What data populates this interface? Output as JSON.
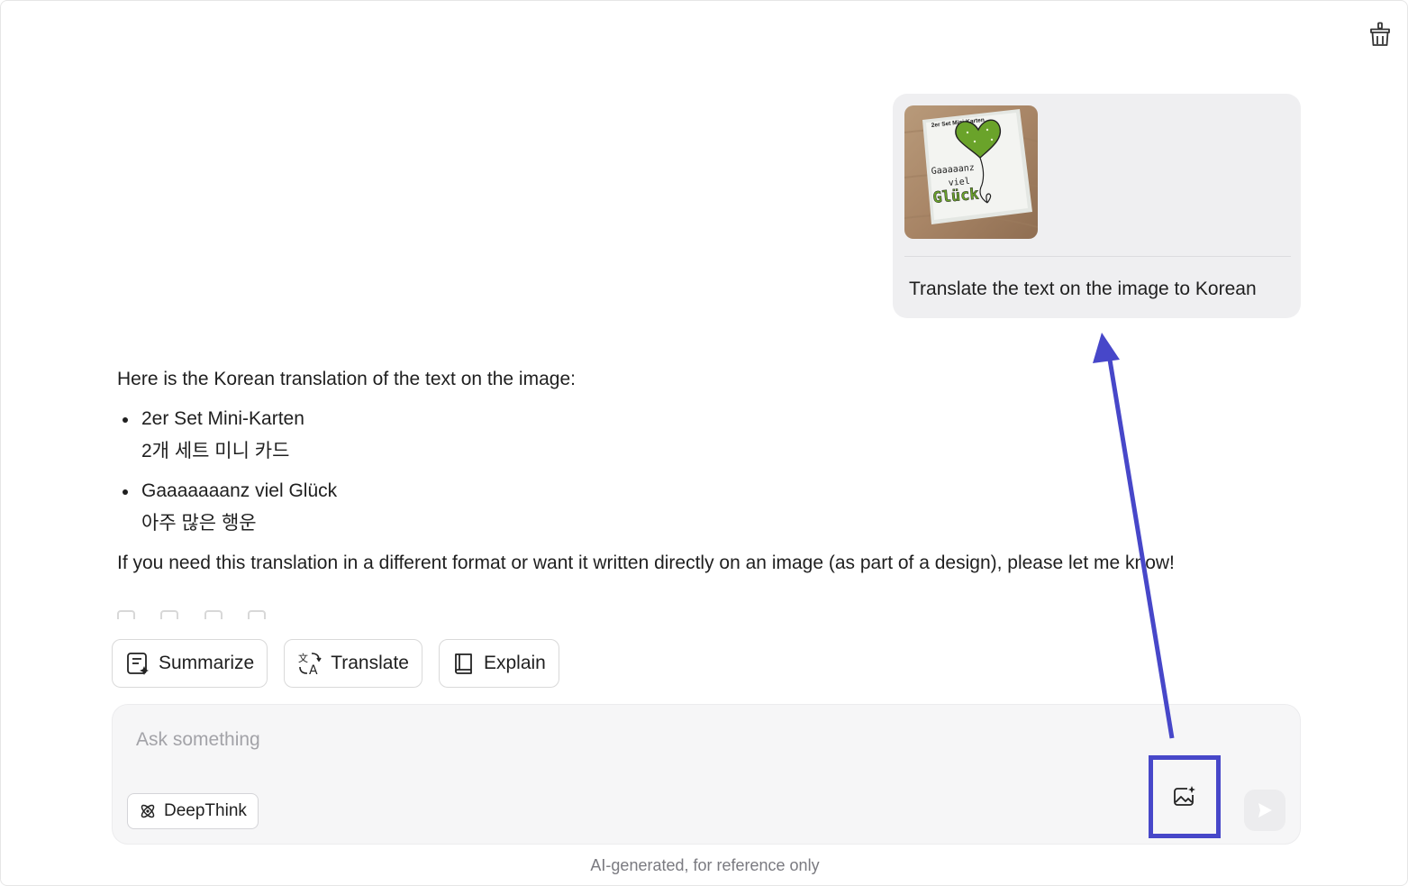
{
  "toolbar": {
    "clear_icon": "clear-chat-icon"
  },
  "user_message": {
    "image": {
      "line1": "2er Set Mini-Karten",
      "line2": "Gaaaaanz",
      "line3": "viel",
      "line4": "Glück"
    },
    "text": "Translate the text on the image to Korean"
  },
  "answer": {
    "intro": "Here is the Korean translation of the text on the image:",
    "items": [
      {
        "original": "2er Set Mini-Karten",
        "translation": "2개 세트 미니 카드"
      },
      {
        "original": "Gaaaaaaanz viel Glück",
        "translation": "아주 많은 행운"
      }
    ],
    "outro": "If you need this translation in a different format or want it written directly on an image (as part of a design), please let me know!"
  },
  "quick_actions": {
    "summarize": "Summarize",
    "translate": "Translate",
    "explain": "Explain"
  },
  "composer": {
    "placeholder": "Ask something",
    "deepthink": "DeepThink",
    "image_icon": "image-generate-icon",
    "send_icon": "send-icon"
  },
  "footer": {
    "note": "AI-generated, for reference only"
  },
  "colors": {
    "highlight": "#4747c9",
    "bubble": "#efeff1",
    "composer": "#f6f6f7"
  }
}
